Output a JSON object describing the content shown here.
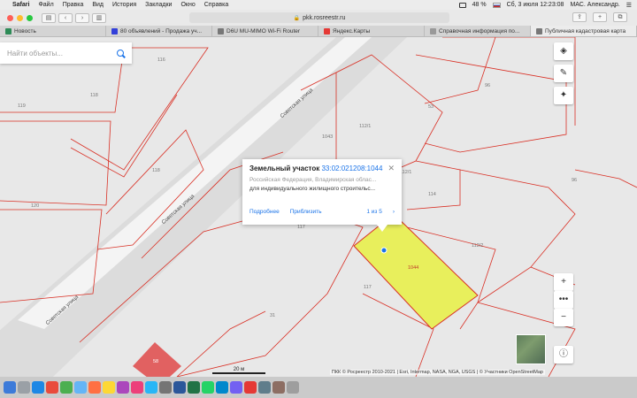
{
  "menubar": {
    "app_name": "Safari",
    "items": [
      "Файл",
      "Правка",
      "Вид",
      "История",
      "Закладки",
      "Окно",
      "Справка"
    ],
    "battery": "48 %",
    "datetime": "Сб, 3 июля  12:23:08",
    "user": "МАС. Александр."
  },
  "toolbar": {
    "url": "pkk.rosreestr.ru"
  },
  "tabs": [
    {
      "label": "Новость",
      "color": "#2e8b57"
    },
    {
      "label": "80 объявлений - Продажа уч...",
      "color": "#3340d9"
    },
    {
      "label": "D6U MU-MIMO Wi-Fi Router",
      "color": "#777777"
    },
    {
      "label": "Яндекс.Карты",
      "color": "#e53935"
    },
    {
      "label": "Справочная информация по...",
      "color": "#999999"
    },
    {
      "label": "Публичная кадастровая карта",
      "color": "#777777"
    }
  ],
  "search": {
    "placeholder": "Найти объекты..."
  },
  "popup": {
    "title": "Земельный участок",
    "cadastral_number": "33:02:021208:1044",
    "address": "Российская Федерация, Владимирская облас...",
    "usage": "для индивидуального жилищного строительс...",
    "link_more": "Подробнее",
    "link_zoom": "Приблизить",
    "page": "1 из 5"
  },
  "map": {
    "parcel_labels": [
      "116",
      "118",
      "119",
      "118",
      "120",
      "96",
      "53",
      "1043",
      "112/1",
      "112/1",
      "114",
      "117",
      "117",
      "112/2",
      "31",
      "96"
    ],
    "highlight_label": "1044",
    "street_name": "Советская улица",
    "scale": "20 м",
    "attribution": "ПКК © Росреестр 2010-2021 | Esri, Intermap, NASA, NGA, USGS | © Участники OpenStreetMap",
    "badge": "58"
  },
  "colors": {
    "parcel_outline": "#d93025",
    "highlight_fill": "#e8ef5c",
    "link": "#1a73e8"
  }
}
